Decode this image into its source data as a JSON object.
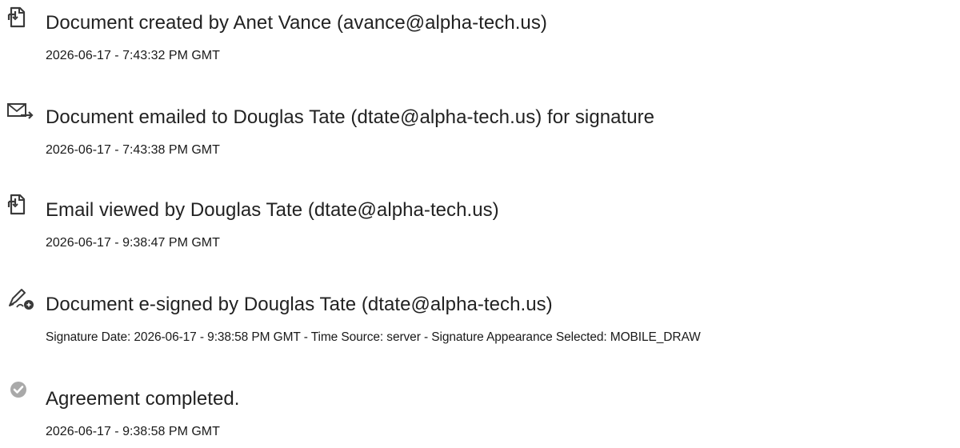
{
  "events": [
    {
      "icon": "document-created-icon",
      "title": "Document created by Anet Vance (avance@alpha-tech.us)",
      "detail": "2026-06-17 - 7:43:32 PM GMT"
    },
    {
      "icon": "email-sent-icon",
      "title": "Document emailed to Douglas Tate (dtate@alpha-tech.us) for signature",
      "detail": "2026-06-17 - 7:43:38 PM GMT"
    },
    {
      "icon": "email-viewed-icon",
      "title": "Email viewed by Douglas Tate (dtate@alpha-tech.us)",
      "detail": "2026-06-17 - 9:38:47 PM GMT"
    },
    {
      "icon": "e-sign-pen-icon",
      "title": "Document e-signed by Douglas Tate (dtate@alpha-tech.us)",
      "detail": "Signature Date: 2026-06-17 - 9:38:58 PM GMT - Time Source: server - Signature Appearance Selected: MOBILE_DRAW"
    },
    {
      "icon": "agreement-completed-check-icon",
      "title": "Agreement completed.",
      "detail": "2026-06-17 - 9:38:58 PM GMT"
    }
  ],
  "colors": {
    "icon_stroke": "#3a3a3a",
    "check_badge": "#a9a9a9",
    "text": "#1f1f1f"
  }
}
